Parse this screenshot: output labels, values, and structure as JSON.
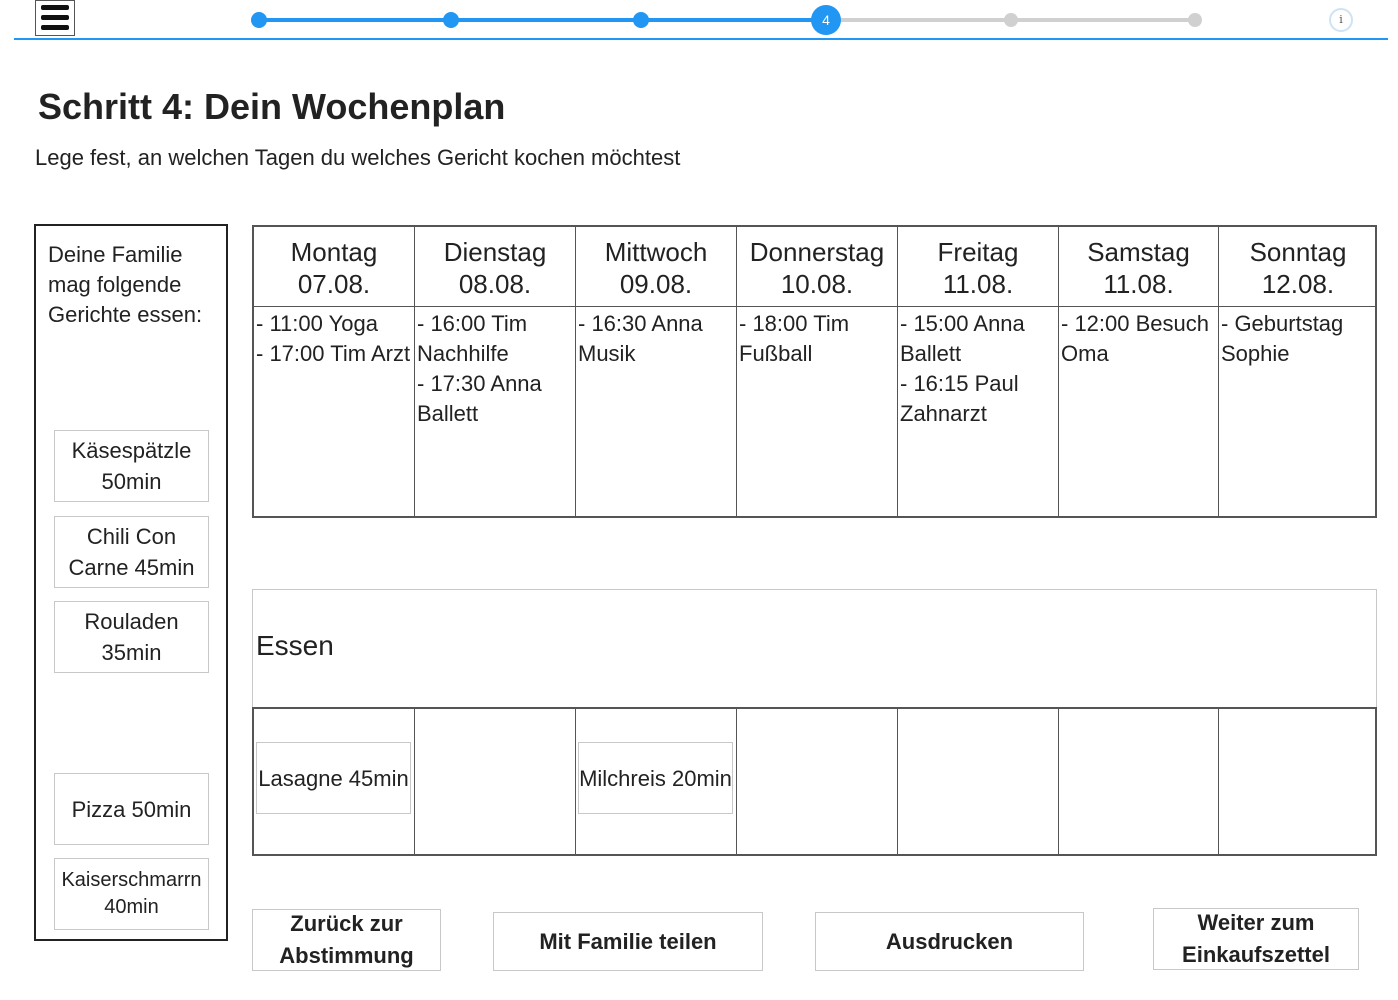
{
  "progress": {
    "current_step_label": "4",
    "total_steps": 6,
    "current_step": 4,
    "accent_color": "#2196f3",
    "inactive_color": "#d0d0d0"
  },
  "header": {
    "title": "Schritt 4: Dein Wochenplan",
    "subtitle": "Lege fest, an welchen Tagen du welches Gericht kochen möchtest"
  },
  "family": {
    "heading": "Deine Familie mag folgende Gerichte essen:",
    "dishes": [
      {
        "label": "Käsespätzle 50min"
      },
      {
        "label": "Chili Con Carne 45min"
      },
      {
        "label": "Rouladen 35min"
      },
      {
        "label": "Pizza 50min"
      },
      {
        "label": "Kaiserschmarrn 40min"
      }
    ]
  },
  "calendar": {
    "days": [
      {
        "name": "Montag",
        "date": "07.08.",
        "events": [
          "- 11:00 Yoga",
          "- 17:00 Tim Arzt"
        ]
      },
      {
        "name": "Dienstag",
        "date": "08.08.",
        "events": [
          "- 16:00 Tim Nachhilfe",
          "- 17:30 Anna Ballett"
        ]
      },
      {
        "name": "Mittwoch",
        "date": "09.08.",
        "events": [
          "- 16:30 Anna Musik"
        ]
      },
      {
        "name": "Donnerstag",
        "date": "10.08.",
        "events": [
          "- 18:00 Tim Fußball"
        ]
      },
      {
        "name": "Freitag",
        "date": "11.08.",
        "events": [
          "- 15:00 Anna Ballett",
          "- 16:15 Paul Zahnarzt"
        ]
      },
      {
        "name": "Samstag",
        "date": "11.08.",
        "events": [
          "- 12:00 Besuch Oma"
        ]
      },
      {
        "name": "Sonntag",
        "date": "12.08.",
        "events": [
          "- Geburtstag Sophie"
        ]
      }
    ]
  },
  "essen": {
    "label": "Essen",
    "meals": [
      {
        "day_index": 0,
        "label": "Lasagne 45min"
      },
      {
        "day_index": 2,
        "label": "Milchreis 20min"
      }
    ]
  },
  "buttons": {
    "back": "Zurück zur Abstimmung",
    "share": "Mit Familie teilen",
    "print": "Ausdrucken",
    "next": "Weiter zum Einkaufszettel"
  }
}
